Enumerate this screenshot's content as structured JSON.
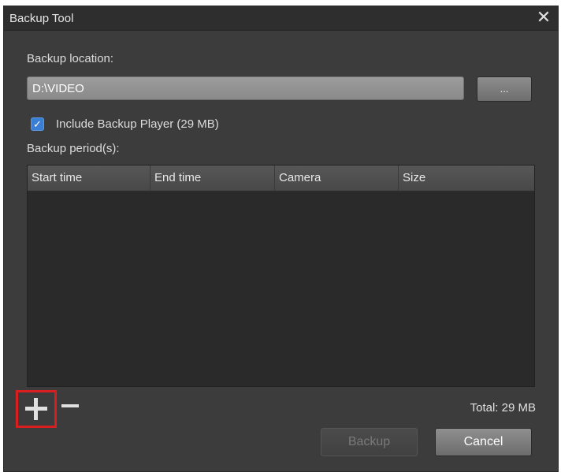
{
  "window": {
    "title": "Backup Tool",
    "close_symbol": "✕"
  },
  "location": {
    "label": "Backup location:",
    "value": "D:\\VIDEO",
    "browse_label": "..."
  },
  "include_player": {
    "checked": true,
    "label": "Include Backup Player (29 MB)"
  },
  "periods": {
    "label": "Backup period(s):",
    "columns": [
      "Start time",
      "End time",
      "Camera",
      "Size"
    ],
    "rows": []
  },
  "footer": {
    "total": "Total: 29 MB",
    "backup_label": "Backup",
    "cancel_label": "Cancel"
  },
  "icons": {
    "add": "plus-icon",
    "remove": "minus-icon",
    "close": "close-icon",
    "check": "checkmark-icon"
  },
  "colors": {
    "window_bg": "#3c3c3c",
    "table_bg": "#2a2a2a",
    "checkbox_accent": "#3a7fd5",
    "highlight": "#d81e1e"
  }
}
